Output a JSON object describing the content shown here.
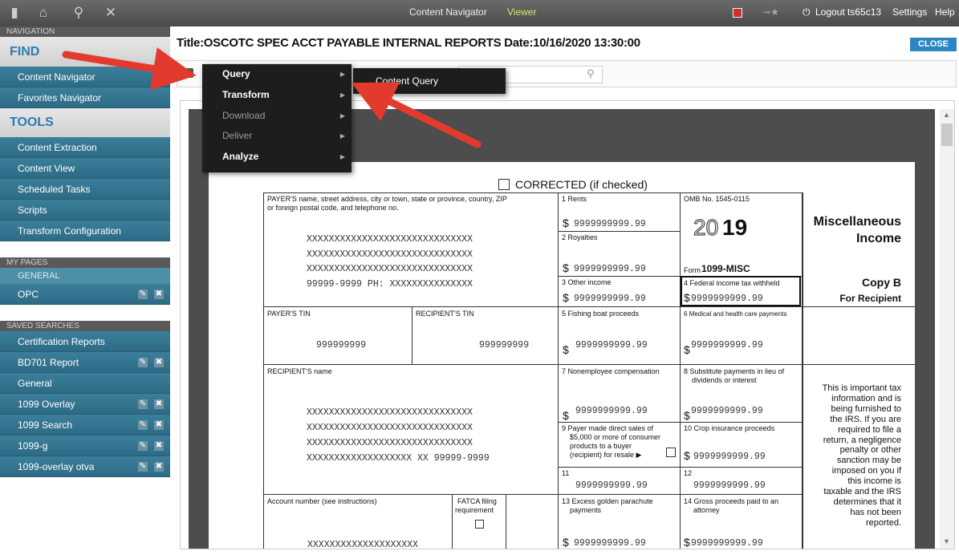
{
  "topbar": {
    "tabs": [
      "Content Navigator",
      "Viewer"
    ],
    "logout": "Logout ts65c13",
    "settings": "Settings",
    "help": "Help"
  },
  "sidebar": {
    "navigation_hdr": "NAVIGATION",
    "find": "FIND",
    "find_items": [
      "Content Navigator",
      "Favorites Navigator"
    ],
    "tools": "TOOLS",
    "tool_items": [
      "Content Extraction",
      "Content View",
      "Scheduled Tasks",
      "Scripts",
      "Transform Configuration"
    ],
    "my_pages_hdr": "MY PAGES",
    "general": "GENERAL",
    "opc": "OPC",
    "saved_hdr": "SAVED SEARCHES",
    "saved_items": [
      "Certification Reports",
      "BD701 Report",
      "General",
      "1099 Overlay",
      "1099 Search",
      "1099-g",
      "1099-overlay otva"
    ]
  },
  "main": {
    "title": "Title:OSCOTC SPEC ACCT PAYABLE INTERNAL REPORTS Date:10/16/2020 13:30:00",
    "close": "CLOSE"
  },
  "menu": {
    "items": [
      "Query",
      "Transform",
      "Download",
      "Deliver",
      "Analyze"
    ],
    "submenu": "Content Query"
  },
  "form": {
    "corrected": "CORRECTED (if checked)",
    "payer_label1": "PAYER'S name, street address, city or town, state or province, country, ZIP",
    "payer_label2": "or foreign postal code, and telephone no.",
    "xline": "XXXXXXXXXXXXXXXXXXXXXXXXXXXXXX",
    "phone": "99999-9999   PH: XXXXXXXXXXXXXXX",
    "rents": "1 Rents",
    "royalties": "2 Royalties",
    "other_income": "3 Other income",
    "fed_tax": "4 Federal income tax withheld",
    "fishing": "5 Fishing boat proceeds",
    "medical": "6 Medical and health care payments",
    "nonemp": "7 Nonemployee compensation",
    "subst1": "8 Substitute payments in lieu of",
    "subst2": "dividends or interest",
    "direct1": "9 Payer made direct sales of",
    "direct2": "$5,000 or more of consumer",
    "direct3": "products to a buyer",
    "direct4": "(recipient) for resale ▶",
    "crop": "10 Crop insurance proceeds",
    "box11": "11",
    "box12": "12",
    "golden1": "13 Excess golden parachute",
    "golden2": "payments",
    "gross1": "14 Gross proceeds paid to an",
    "gross2": "attorney",
    "omb": "OMB No. 1545-0115",
    "year_outline": "20",
    "year_bold": "19",
    "form_label": "Form",
    "form_name": "1099-MISC",
    "misc1": "Miscellaneous",
    "misc2": "Income",
    "copyb": "Copy B",
    "for_recipient": "For Recipient",
    "payer_tin": "PAYER'S TIN",
    "recip_tin": "RECIPIENT'S TIN",
    "tin_value": "999999999",
    "recip_name": "RECIPIENT'S name",
    "recip_addr": "XXXXXXXXXXXXXXXXXXX  XX 99999-9999",
    "account": "Account number (see instructions)",
    "fatca1": "FATCA filing",
    "fatca2": "requirement",
    "acct_value": "XXXXXXXXXXXXXXXXXXXX",
    "amount": "9999999999.99",
    "dollar": "$",
    "notice": [
      "This is important tax",
      "information and is",
      "being furnished to",
      "the IRS. If you are",
      "required to file a",
      "return, a negligence",
      "penalty or other",
      "sanction may be",
      "imposed on you if",
      "this income is",
      "taxable and the IRS",
      "determines that it",
      "has not been",
      "reported."
    ]
  }
}
